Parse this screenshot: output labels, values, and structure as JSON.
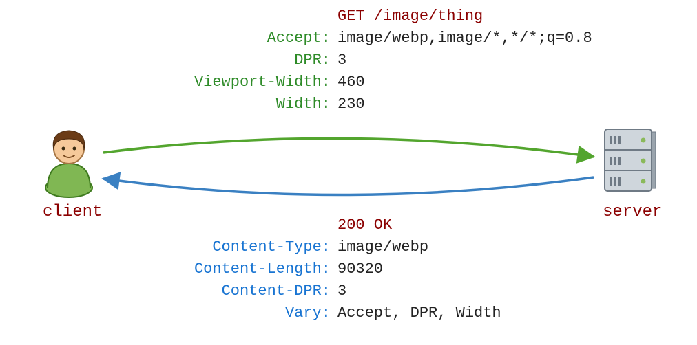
{
  "labels": {
    "client": "client",
    "server": "server"
  },
  "request": {
    "line": "GET /image/thing",
    "headers": [
      {
        "name": "Accept:",
        "value": "image/webp,image/*,*/*;q=0.8"
      },
      {
        "name": "DPR:",
        "value": "3"
      },
      {
        "name": "Viewport-Width:",
        "value": "460"
      },
      {
        "name": "Width:",
        "value": "230"
      }
    ]
  },
  "response": {
    "line": "200 OK",
    "headers": [
      {
        "name": "Content-Type:",
        "value": "image/webp"
      },
      {
        "name": "Content-Length:",
        "value": "90320"
      },
      {
        "name": "Content-DPR:",
        "value": "3"
      },
      {
        "name": "Vary:",
        "value": "Accept, DPR, Width"
      }
    ]
  },
  "colors": {
    "green": "#53a52e",
    "blue": "#3a80c2"
  }
}
